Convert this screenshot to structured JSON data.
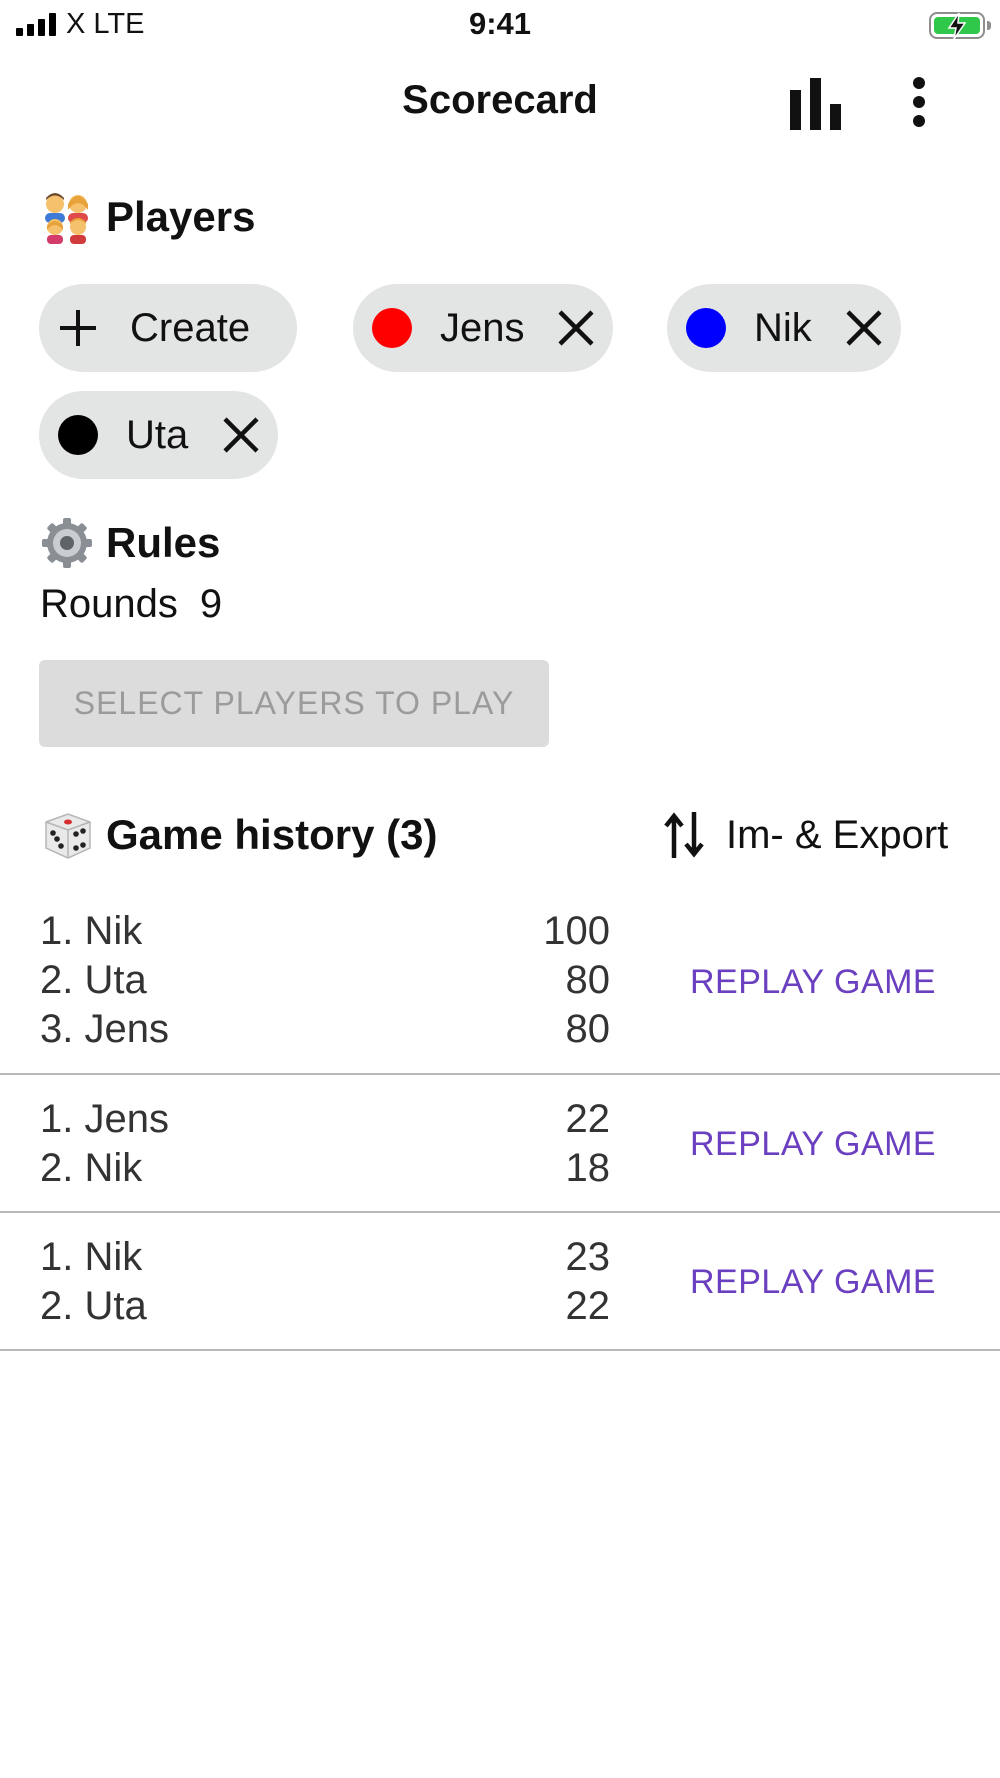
{
  "status": {
    "carrier": "X  LTE",
    "time": "9:41"
  },
  "appbar": {
    "title": "Scorecard",
    "icons": [
      "bar-chart-icon",
      "more-vert-icon"
    ]
  },
  "players": {
    "title": "Players",
    "create_label": "Create",
    "list": [
      {
        "name": "Jens",
        "color": "#ff0000"
      },
      {
        "name": "Nik",
        "color": "#0000ff"
      },
      {
        "name": "Uta",
        "color": "#000000"
      }
    ]
  },
  "rules": {
    "title": "Rules",
    "rounds_label": "Rounds",
    "rounds_value": "9"
  },
  "play_button": "SELECT PLAYERS TO PLAY",
  "history": {
    "title": "Game history (3)",
    "imexport_label": "Im- & Export",
    "replay_label": "REPLAY GAME",
    "games": [
      {
        "rows": [
          {
            "name": "1. Nik",
            "score": "100"
          },
          {
            "name": "2. Uta",
            "score": "80"
          },
          {
            "name": "3. Jens",
            "score": "80"
          }
        ]
      },
      {
        "rows": [
          {
            "name": "1. Jens",
            "score": "22"
          },
          {
            "name": "2. Nik",
            "score": "18"
          }
        ]
      },
      {
        "rows": [
          {
            "name": "1. Nik",
            "score": "23"
          },
          {
            "name": "2. Uta",
            "score": "22"
          }
        ]
      }
    ]
  },
  "colors": {
    "accent": "#6a3fc0",
    "chip_bg": "#e3e4e4",
    "disabled_bg": "#dcdcdc"
  }
}
